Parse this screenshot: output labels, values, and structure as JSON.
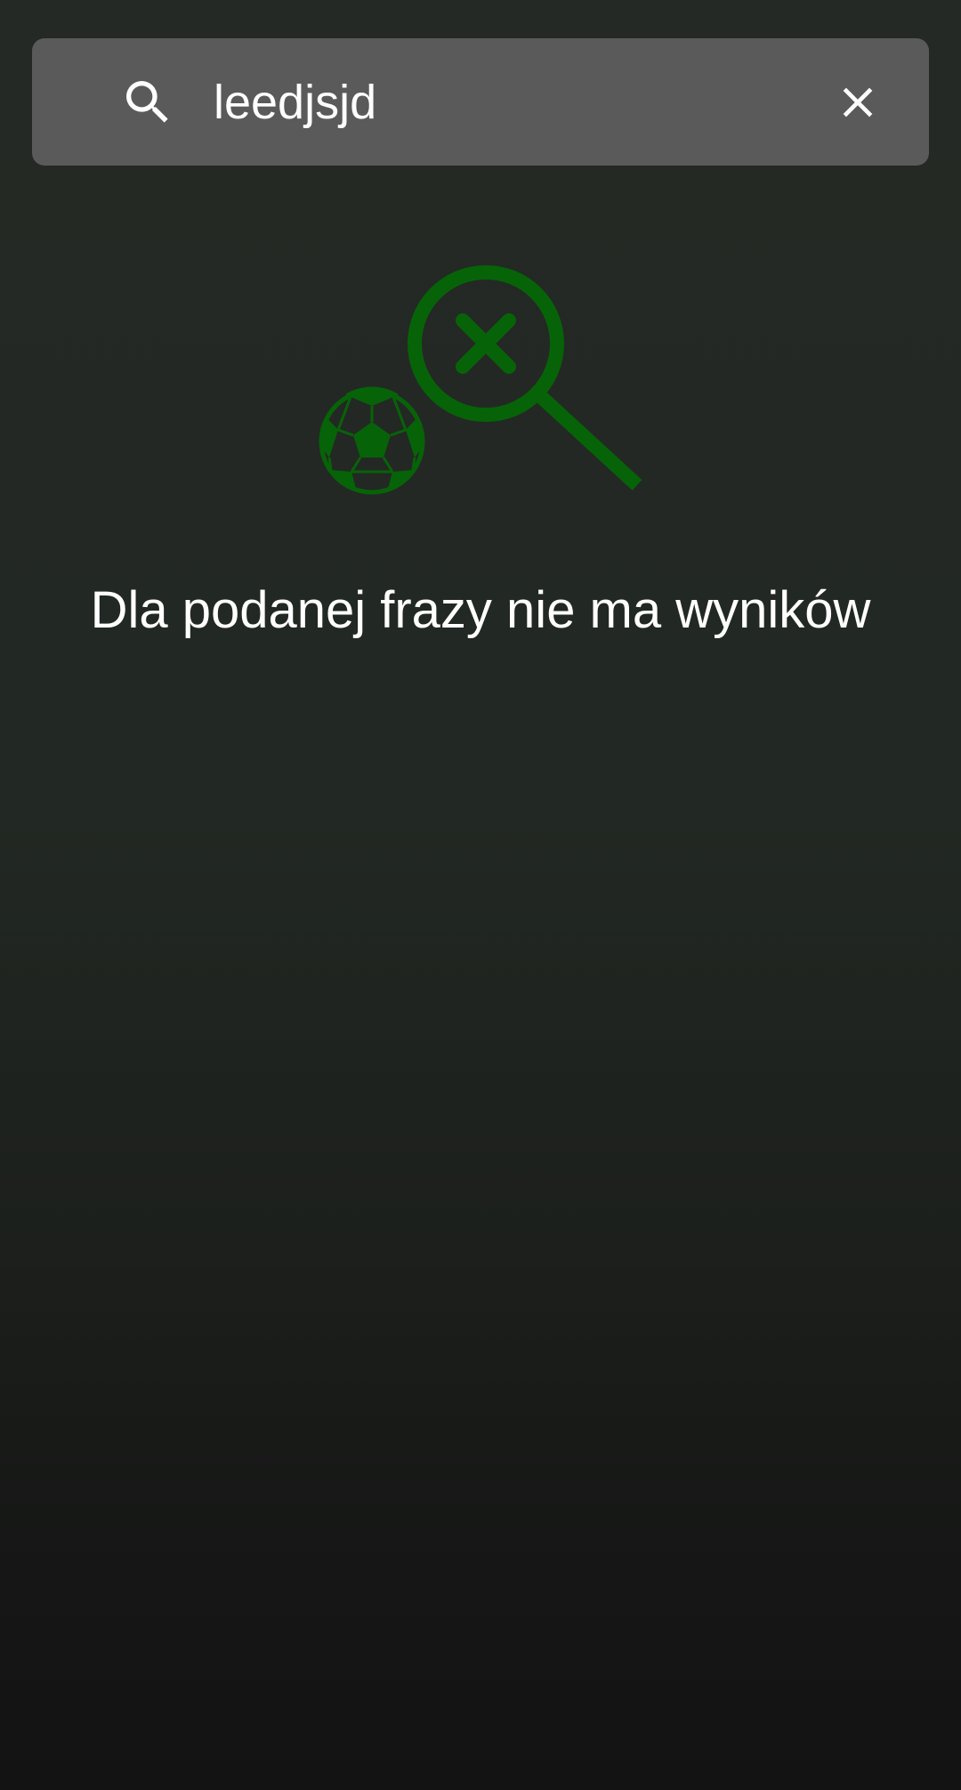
{
  "search": {
    "value": "leedjsjd",
    "placeholder": "",
    "search_icon": "search-icon",
    "clear_icon": "close-icon"
  },
  "empty_state": {
    "illustration_icons": [
      "soccer-ball-icon",
      "magnifier-x-icon"
    ],
    "message": "Dla podanej frazy nie ma wyników"
  },
  "colors": {
    "accent": "#076307",
    "search_bar_bg": "#5a5a5a",
    "text": "#ffffff"
  }
}
